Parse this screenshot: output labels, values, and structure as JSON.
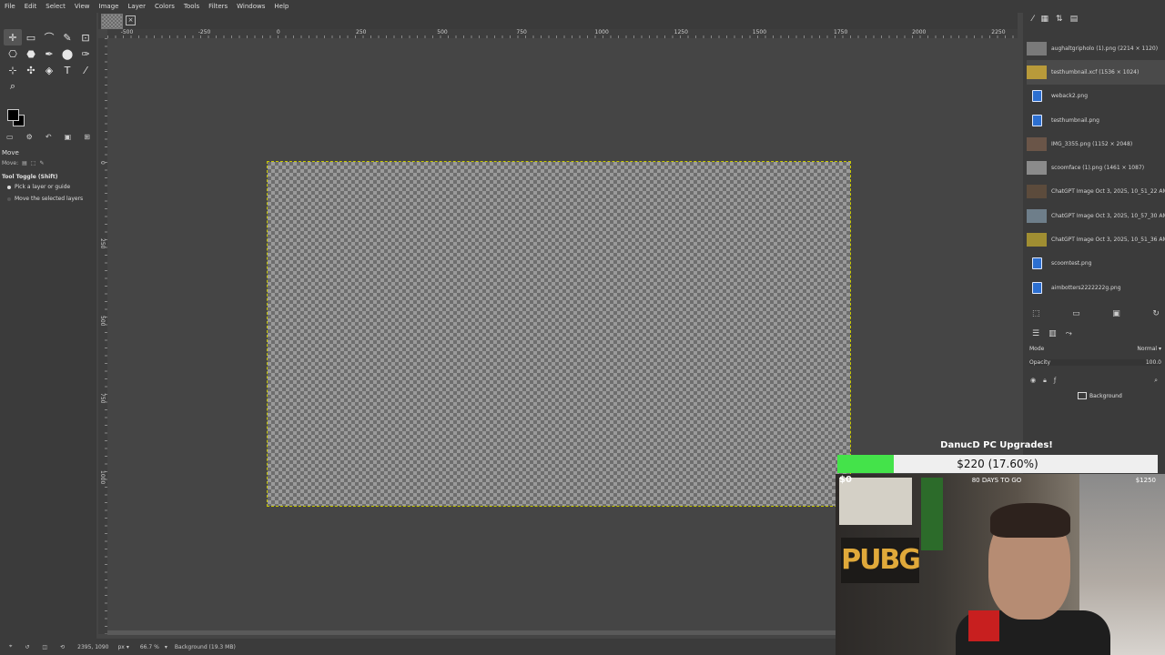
{
  "menu": [
    "File",
    "Edit",
    "Select",
    "View",
    "Image",
    "Layer",
    "Colors",
    "Tools",
    "Filters",
    "Windows",
    "Help"
  ],
  "tab_close": "×",
  "tools": [
    "✛",
    "▭",
    "⌒",
    "✎",
    "⊡",
    "⎔",
    "⬣",
    "✒",
    "⬤",
    "✑",
    "⊹",
    "✣",
    "◈",
    "T",
    "⁄",
    "⌕"
  ],
  "tool_options": {
    "title": "Move",
    "move_label": "Move:",
    "toggle_label": "Tool Toggle  (Shift)",
    "option_pick": "Pick a layer or guide",
    "option_move": "Move the selected layers"
  },
  "hruler_labels": [
    {
      "text": "-500",
      "pos": 14
    },
    {
      "text": "-250",
      "pos": 95
    },
    {
      "text": "0",
      "pos": 177
    },
    {
      "text": "250",
      "pos": 260
    },
    {
      "text": "500",
      "pos": 345
    },
    {
      "text": "750",
      "pos": 428
    },
    {
      "text": "1000",
      "pos": 510
    },
    {
      "text": "1250",
      "pos": 593
    },
    {
      "text": "1500",
      "pos": 675
    },
    {
      "text": "1750",
      "pos": 760
    },
    {
      "text": "2000",
      "pos": 842
    },
    {
      "text": "2250",
      "pos": 925
    }
  ],
  "vruler_labels": [
    {
      "text": "0",
      "pos": 135
    },
    {
      "text": "250",
      "pos": 220
    },
    {
      "text": "500",
      "pos": 305
    },
    {
      "text": "750",
      "pos": 390
    },
    {
      "text": "1000",
      "pos": 475
    }
  ],
  "status": {
    "coords": "2395, 1090",
    "unit": "px",
    "zoom": "66.7 %",
    "layer_info": "Background (19.3 MB)"
  },
  "images": [
    {
      "name": "aughaltgripholo (1).png (2214 × 1120)",
      "thumb": "photo",
      "color": "#7a7a7a"
    },
    {
      "name": "testhumbnail.xcf (1536 × 1024)",
      "thumb": "photo",
      "color": "#b89a3a",
      "selected": true
    },
    {
      "name": "weback2.png",
      "thumb": "file"
    },
    {
      "name": "testhumbnail.png",
      "thumb": "file"
    },
    {
      "name": "IMG_3355.png (1152 × 2048)",
      "thumb": "photo",
      "color": "#6a5548"
    },
    {
      "name": "scoomface (1).png (1461 × 1087)",
      "thumb": "photo",
      "color": "#8b8b8b"
    },
    {
      "name": "ChatGPT Image Oct 3, 2025, 10_51_22 AM",
      "thumb": "photo",
      "color": "#5c4b3c"
    },
    {
      "name": "ChatGPT Image Oct 3, 2025, 10_57_30 AM",
      "thumb": "photo",
      "color": "#6e7e8a"
    },
    {
      "name": "ChatGPT Image Oct 3, 2025, 10_51_36 AM",
      "thumb": "photo",
      "color": "#a08e32"
    },
    {
      "name": "scoomtest.png",
      "thumb": "file"
    },
    {
      "name": "aimbotters2222222g.png",
      "thumb": "file"
    }
  ],
  "layers": {
    "mode_label": "Mode",
    "mode_value": "Normal ▾",
    "opacity_label": "Opacity",
    "opacity_value": "100.0",
    "layer_name": "Background"
  },
  "donation": {
    "title": "DanucD PC Upgrades!",
    "amount": "$220 (17.60%)",
    "progress_fraction": 0.176,
    "low_label": "$0",
    "days_label": "80 DAYS TO GO",
    "high_label": "$1250"
  },
  "webcam": {
    "poster_text": "PUBG"
  }
}
